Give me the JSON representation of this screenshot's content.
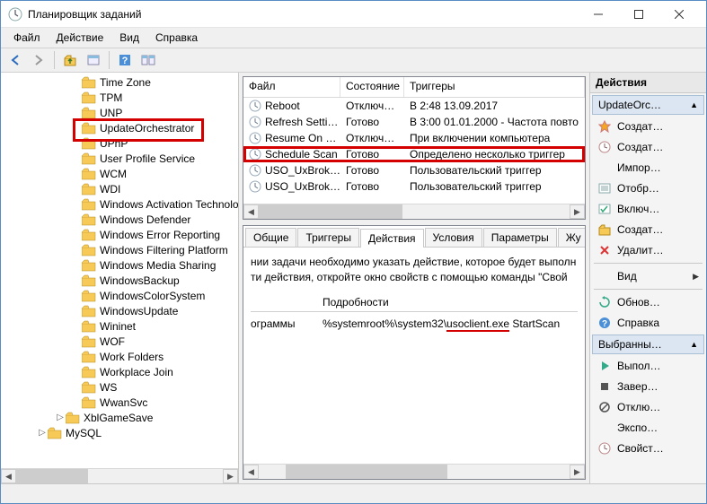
{
  "title": "Планировщик заданий",
  "menu": {
    "file": "Файл",
    "action": "Действие",
    "view": "Вид",
    "help": "Справка"
  },
  "tree": {
    "items": [
      {
        "label": "Time Zone",
        "level": 4
      },
      {
        "label": "TPM",
        "level": 4
      },
      {
        "label": "UNP",
        "level": 4
      },
      {
        "label": "UpdateOrchestrator",
        "level": 4,
        "highlight": true
      },
      {
        "label": "UPnP",
        "level": 4
      },
      {
        "label": "User Profile Service",
        "level": 4
      },
      {
        "label": "WCM",
        "level": 4
      },
      {
        "label": "WDI",
        "level": 4
      },
      {
        "label": "Windows Activation Technologies",
        "level": 4
      },
      {
        "label": "Windows Defender",
        "level": 4
      },
      {
        "label": "Windows Error Reporting",
        "level": 4
      },
      {
        "label": "Windows Filtering Platform",
        "level": 4
      },
      {
        "label": "Windows Media Sharing",
        "level": 4
      },
      {
        "label": "WindowsBackup",
        "level": 4
      },
      {
        "label": "WindowsColorSystem",
        "level": 4
      },
      {
        "label": "WindowsUpdate",
        "level": 4
      },
      {
        "label": "Wininet",
        "level": 4
      },
      {
        "label": "WOF",
        "level": 4
      },
      {
        "label": "Work Folders",
        "level": 4
      },
      {
        "label": "Workplace Join",
        "level": 4
      },
      {
        "label": "WS",
        "level": 4
      },
      {
        "label": "WwanSvc",
        "level": 4
      },
      {
        "label": "XblGameSave",
        "level": 3
      },
      {
        "label": "MySQL",
        "level": 2
      }
    ]
  },
  "taskList": {
    "headers": {
      "name": "Файл",
      "state": "Состояние",
      "triggers": "Триггеры"
    },
    "rows": [
      {
        "name": "Reboot",
        "state": "Отключено",
        "trigger": "В 2:48 13.09.2017"
      },
      {
        "name": "Refresh Setti…",
        "state": "Готово",
        "trigger": "В 3:00 01.01.2000 - Частота повто"
      },
      {
        "name": "Resume On …",
        "state": "Отключено",
        "trigger": "При включении компьютера"
      },
      {
        "name": "Schedule Scan",
        "state": "Готово",
        "trigger": "Определено несколько триггер",
        "highlight": true
      },
      {
        "name": "USO_UxBrok…",
        "state": "Готово",
        "trigger": "Пользовательский триггер"
      },
      {
        "name": "USO_UxBrok…",
        "state": "Готово",
        "trigger": "Пользовательский триггер"
      }
    ]
  },
  "detail": {
    "tabs": {
      "general": "Общие",
      "triggers": "Триггеры",
      "actions": "Действия",
      "conditions": "Условия",
      "params": "Параметры",
      "history": "Жу"
    },
    "text1": "нии задачи необходимо указать действие, которое будет выполн",
    "text2": "ти действия, откройте окно свойств с помощью команды \"Свой",
    "col_details": "Подробности",
    "val_action": "ограммы",
    "val_details_prefix": "%systemroot%\\system32\\",
    "val_details_underlined": "usoclient.exe",
    "val_details_suffix": " StartScan"
  },
  "actions": {
    "header": "Действия",
    "sections": {
      "folder": "UpdateOrc…",
      "selected": "Выбранны…"
    },
    "items": {
      "create": "Создат…",
      "create2": "Создат…",
      "import": "Импор…",
      "display": "Отобр…",
      "enable": "Включ…",
      "newfolder": "Создат…",
      "delete": "Удалит…",
      "view": "Вид",
      "refresh": "Обнов…",
      "help": "Справка",
      "run": "Выпол…",
      "end": "Завер…",
      "disable": "Отклю…",
      "export": "Экспо…",
      "props": "Свойст…"
    }
  }
}
